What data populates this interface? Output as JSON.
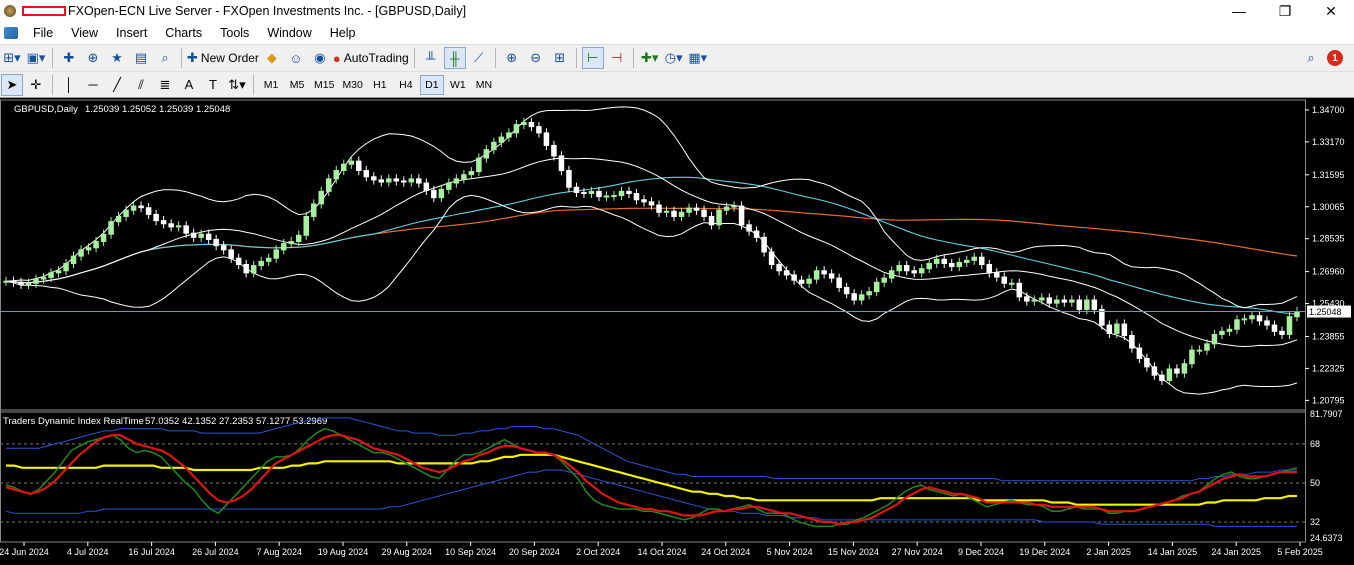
{
  "window": {
    "title": "FXOpen-ECN Live Server - FXOpen Investments Inc. - [GBPUSD,Daily]",
    "controls": {
      "minimize": "—",
      "restore": "❐",
      "close": "✕"
    }
  },
  "menu": [
    "File",
    "View",
    "Insert",
    "Charts",
    "Tools",
    "Window",
    "Help"
  ],
  "child_controls": {
    "minimize": "_",
    "restore": "🗗",
    "close": "✕"
  },
  "toolbar": {
    "new_order_label": "New Order",
    "autotrading_label": "AutoTrading",
    "notification_count": "1"
  },
  "timeframes": [
    "M1",
    "M5",
    "M15",
    "M30",
    "H1",
    "H4",
    "D1",
    "W1",
    "MN"
  ],
  "active_timeframe": "D1",
  "colors": {
    "background": "#000000",
    "bull_candle": "#a6f0a0",
    "bear_candle": "#ffffff",
    "bollinger": "#ffffff",
    "ma_medium": "#5fd3df",
    "ma_slow": "#e86b2a",
    "tdi_green": "#1e8a1e",
    "tdi_red": "#e11414",
    "tdi_yellow": "#f2f200",
    "tdi_blue": "#2a55d8",
    "current_price_line": "#6f99b8"
  },
  "chart_data": [
    {
      "type": "candlestick",
      "title": "GBPUSD,Daily",
      "ohlc_header": "1.25039 1.25052 1.25039 1.25048",
      "current_price": 1.25048,
      "current_price_label": "1.25048",
      "ylim": [
        1.2043,
        1.3508
      ],
      "yticks": [
        "1.34700",
        "1.33170",
        "1.31595",
        "1.30065",
        "1.28535",
        "1.26960",
        "1.25430",
        "1.23855",
        "1.22325",
        "1.20795"
      ],
      "x_ticks": [
        "24 Jun 2024",
        "4 Jul 2024",
        "16 Jul 2024",
        "26 Jul 2024",
        "7 Aug 2024",
        "19 Aug 2024",
        "29 Aug 2024",
        "10 Sep 2024",
        "20 Sep 2024",
        "2 Oct 2024",
        "14 Oct 2024",
        "24 Oct 2024",
        "5 Nov 2024",
        "15 Nov 2024",
        "27 Nov 2024",
        "9 Dec 2024",
        "19 Dec 2024",
        "2 Jan 2025",
        "14 Jan 2025",
        "24 Jan 2025",
        "5 Feb 2025"
      ],
      "closes": [
        1.265,
        1.2645,
        1.2635,
        1.264,
        1.266,
        1.2668,
        1.269,
        1.27,
        1.2735,
        1.277,
        1.28,
        1.281,
        1.284,
        1.2875,
        1.2935,
        1.296,
        1.299,
        1.301,
        1.3002,
        1.297,
        1.294,
        1.2925,
        1.291,
        1.2915,
        1.288,
        1.286,
        1.2875,
        1.285,
        1.282,
        1.28,
        1.276,
        1.273,
        1.269,
        1.2725,
        1.2745,
        1.276,
        1.28,
        1.283,
        1.284,
        1.287,
        1.296,
        1.302,
        1.308,
        1.314,
        1.318,
        1.321,
        1.3225,
        1.318,
        1.315,
        1.3135,
        1.3125,
        1.314,
        1.313,
        1.3125,
        1.314,
        1.312,
        1.3085,
        1.305,
        1.309,
        1.312,
        1.314,
        1.316,
        1.3175,
        1.324,
        1.328,
        1.3315,
        1.334,
        1.336,
        1.34,
        1.341,
        1.339,
        1.336,
        1.33,
        1.325,
        1.318,
        1.31,
        1.3075,
        1.307,
        1.308,
        1.3055,
        1.3058,
        1.306,
        1.308,
        1.307,
        1.304,
        1.303,
        1.3015,
        1.298,
        1.2985,
        1.296,
        1.298,
        1.3,
        1.299,
        1.296,
        1.292,
        1.299,
        1.3005,
        1.301,
        1.292,
        1.289,
        1.286,
        1.279,
        1.273,
        1.27,
        1.268,
        1.2655,
        1.264,
        1.266,
        1.27,
        1.2685,
        1.2665,
        1.262,
        1.259,
        1.256,
        1.2585,
        1.26,
        1.2645,
        1.2665,
        1.27,
        1.2725,
        1.27,
        1.269,
        1.271,
        1.2735,
        1.2755,
        1.2735,
        1.272,
        1.274,
        1.275,
        1.2765,
        1.273,
        1.269,
        1.267,
        1.264,
        1.264,
        1.2575,
        1.2555,
        1.256,
        1.257,
        1.2545,
        1.256,
        1.255,
        1.256,
        1.2515,
        1.256,
        1.2515,
        1.244,
        1.24,
        1.2445,
        1.239,
        1.233,
        1.228,
        1.224,
        1.22,
        1.2175,
        1.223,
        1.221,
        1.2255,
        1.232,
        1.232,
        1.235,
        1.2395,
        1.241,
        1.242,
        1.2465,
        1.247,
        1.2485,
        1.246,
        1.244,
        1.241,
        1.2395,
        1.248,
        1.2505
      ]
    },
    {
      "type": "line",
      "title": "Traders Dynamic Index RealTime",
      "header_values": "57.0352 42.1352 27.2353 57.1277 53.2969",
      "ylim": [
        24.6373,
        81.7907
      ],
      "yticks": [
        "81.7907",
        "68",
        "50",
        "32",
        "24.6373"
      ],
      "levels": [
        68,
        50,
        32
      ],
      "series": [
        {
          "name": "Green",
          "values": [
            49,
            48,
            46,
            45,
            47,
            51,
            55,
            60,
            65,
            67,
            69,
            70,
            71,
            72,
            70,
            66,
            64,
            65,
            64,
            62,
            58,
            54,
            50,
            47,
            42,
            38,
            36,
            40,
            44,
            48,
            52,
            56,
            60,
            62,
            62,
            63,
            66,
            70,
            73,
            75,
            74,
            72,
            70,
            68,
            66,
            64,
            64,
            63,
            61,
            59,
            57,
            55,
            53,
            52,
            56,
            60,
            63,
            63,
            64,
            66,
            68,
            70,
            68,
            66,
            65,
            64,
            64,
            63,
            60,
            56,
            52,
            46,
            42,
            40,
            39,
            38,
            38,
            38,
            37,
            37,
            36,
            35,
            34,
            33,
            34,
            36,
            38,
            38,
            37,
            38,
            39,
            40,
            38,
            36,
            36,
            36,
            34,
            32,
            31,
            30,
            30,
            30,
            31,
            31,
            33,
            34,
            36,
            38,
            40,
            43,
            46,
            48,
            49,
            47,
            46,
            45,
            44,
            45,
            43,
            41,
            39,
            40,
            41,
            42,
            41,
            40,
            40,
            39,
            37,
            37,
            38,
            39,
            38,
            38,
            38,
            36,
            36,
            37,
            37,
            38,
            39,
            40,
            41,
            42,
            44,
            45,
            46,
            49,
            52,
            54,
            55,
            53,
            52,
            52,
            53,
            54,
            55,
            56,
            57
          ]
        },
        {
          "name": "Red",
          "values": [
            48,
            47,
            46,
            45,
            46,
            48,
            51,
            55,
            59,
            63,
            66,
            69,
            71,
            72,
            72,
            70,
            68,
            67,
            66,
            65,
            63,
            60,
            57,
            53,
            49,
            45,
            42,
            41,
            42,
            44,
            47,
            51,
            55,
            59,
            61,
            63,
            65,
            67,
            69,
            71,
            72,
            72,
            71,
            70,
            68,
            66,
            65,
            64,
            63,
            61,
            59,
            57,
            56,
            55,
            56,
            58,
            60,
            61,
            63,
            64,
            66,
            67,
            67,
            66,
            65,
            64,
            64,
            63,
            61,
            58,
            55,
            51,
            48,
            45,
            43,
            41,
            40,
            39,
            38,
            38,
            37,
            37,
            36,
            35,
            35,
            35,
            36,
            37,
            37,
            38,
            38,
            39,
            39,
            38,
            37,
            36,
            36,
            35,
            34,
            33,
            32,
            32,
            31,
            32,
            32,
            33,
            34,
            36,
            38,
            40,
            43,
            45,
            47,
            48,
            47,
            46,
            45,
            45,
            44,
            43,
            41,
            41,
            41,
            41,
            41,
            41,
            40,
            40,
            39,
            39,
            39,
            39,
            39,
            39,
            38,
            37,
            37,
            37,
            37,
            38,
            39,
            40,
            41,
            42,
            43,
            45,
            46,
            48,
            50,
            52,
            53,
            54,
            53,
            53,
            53,
            54,
            55,
            55,
            55
          ]
        },
        {
          "name": "Yellow",
          "values": [
            58,
            58,
            57,
            57,
            57,
            57,
            57,
            57,
            57,
            57,
            57,
            57,
            58,
            58,
            58,
            58,
            58,
            58,
            58,
            57,
            57,
            57,
            57,
            56,
            56,
            56,
            56,
            56,
            56,
            56,
            56,
            57,
            57,
            57,
            57,
            58,
            58,
            59,
            59,
            60,
            60,
            60,
            60,
            60,
            60,
            60,
            60,
            60,
            59,
            59,
            59,
            59,
            59,
            59,
            59,
            59,
            59,
            59,
            60,
            60,
            61,
            62,
            62,
            63,
            63,
            63,
            63,
            63,
            62,
            61,
            60,
            59,
            58,
            57,
            56,
            55,
            54,
            53,
            52,
            51,
            50,
            49,
            48,
            47,
            46,
            46,
            45,
            45,
            44,
            44,
            43,
            43,
            42,
            42,
            42,
            42,
            42,
            42,
            42,
            42,
            42,
            42,
            42,
            42,
            42,
            42,
            42,
            43,
            43,
            43,
            43,
            43,
            43,
            43,
            43,
            43,
            43,
            43,
            43,
            42,
            42,
            42,
            42,
            42,
            42,
            42,
            42,
            42,
            41,
            41,
            41,
            40,
            40,
            40,
            40,
            40,
            40,
            40,
            40,
            40,
            40,
            40,
            40,
            40,
            40,
            40,
            40,
            41,
            41,
            42,
            42,
            42,
            42,
            42,
            43,
            43,
            43,
            44,
            44
          ]
        },
        {
          "name": "Upper Band",
          "values": [
            66,
            66,
            66,
            66,
            66,
            67,
            68,
            69,
            70,
            71,
            72,
            73,
            74,
            74,
            75,
            75,
            75,
            75,
            75,
            75,
            74,
            74,
            74,
            74,
            73,
            73,
            73,
            73,
            73,
            73,
            73,
            73,
            74,
            75,
            76,
            77,
            78,
            79,
            79,
            80,
            80,
            80,
            80,
            79,
            78,
            77,
            76,
            75,
            74,
            74,
            73,
            73,
            73,
            72,
            72,
            72,
            73,
            73,
            74,
            74,
            75,
            75,
            76,
            76,
            76,
            76,
            75,
            75,
            74,
            73,
            72,
            70,
            68,
            66,
            64,
            62,
            60,
            59,
            58,
            57,
            56,
            55,
            54,
            54,
            53,
            53,
            53,
            53,
            53,
            53,
            53,
            53,
            53,
            53,
            52,
            52,
            52,
            52,
            52,
            52,
            52,
            52,
            52,
            52,
            52,
            52,
            52,
            52,
            52,
            52,
            52,
            52,
            52,
            52,
            52,
            52,
            52,
            52,
            52,
            52,
            52,
            52,
            51,
            51,
            51,
            51,
            51,
            51,
            51,
            51,
            51,
            51,
            51,
            51,
            51,
            51,
            51,
            51,
            51,
            51,
            51,
            51,
            51,
            51,
            51,
            51,
            52,
            52,
            53,
            53,
            54,
            54,
            54,
            55,
            55,
            55,
            56,
            56,
            56
          ]
        },
        {
          "name": "Lower Band",
          "values": [
            37,
            36,
            36,
            36,
            36,
            36,
            36,
            36,
            36,
            36,
            37,
            37,
            38,
            38,
            38,
            38,
            38,
            38,
            38,
            38,
            38,
            38,
            38,
            38,
            38,
            38,
            38,
            38,
            38,
            38,
            38,
            38,
            38,
            38,
            38,
            38,
            38,
            38,
            38,
            38,
            38,
            38,
            38,
            38,
            38,
            38,
            38,
            39,
            39,
            40,
            41,
            42,
            43,
            44,
            45,
            46,
            47,
            48,
            49,
            50,
            51,
            52,
            53,
            54,
            55,
            55,
            56,
            56,
            56,
            55,
            54,
            53,
            52,
            51,
            50,
            49,
            48,
            47,
            46,
            45,
            44,
            43,
            42,
            41,
            40,
            39,
            38,
            38,
            37,
            37,
            36,
            36,
            36,
            35,
            35,
            35,
            34,
            34,
            34,
            34,
            33,
            33,
            33,
            33,
            33,
            33,
            33,
            33,
            33,
            33,
            33,
            33,
            33,
            33,
            33,
            33,
            33,
            33,
            33,
            33,
            33,
            33,
            33,
            33,
            33,
            33,
            33,
            32,
            32,
            32,
            32,
            32,
            32,
            32,
            31,
            31,
            31,
            31,
            31,
            31,
            31,
            31,
            31,
            31,
            31,
            31,
            31,
            31,
            30,
            30,
            30,
            30,
            30,
            30,
            30,
            30,
            30,
            30,
            30
          ]
        }
      ]
    }
  ]
}
